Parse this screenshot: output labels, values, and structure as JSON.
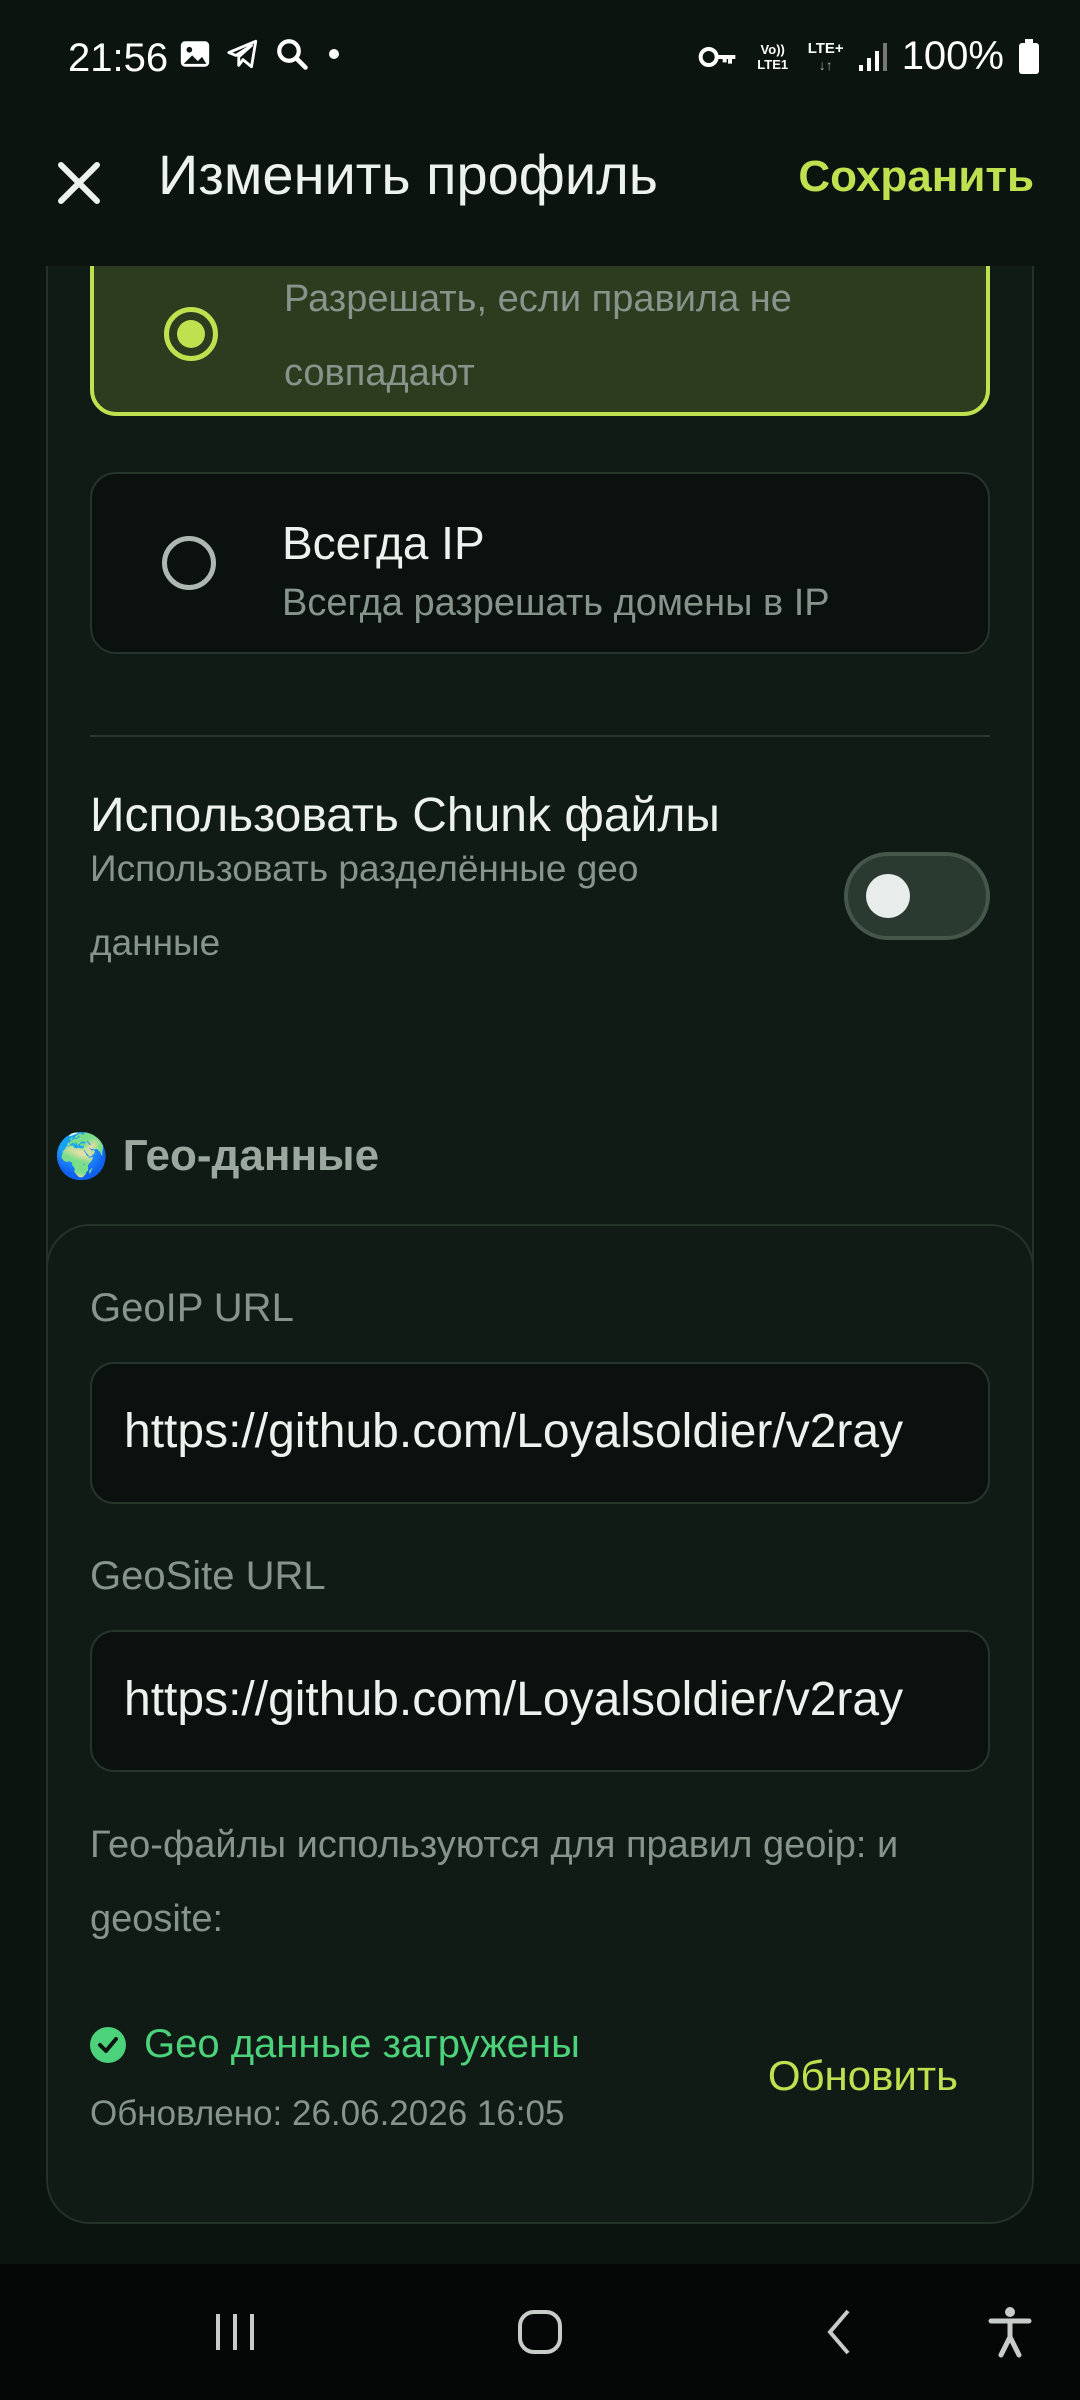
{
  "status_bar": {
    "time": "21:56",
    "network": "Vo)) LTE1",
    "lte": "LTE+",
    "battery": "100%"
  },
  "app_bar": {
    "title": "Изменить профиль",
    "save_label": "Сохранить"
  },
  "dns_options": [
    {
      "title": "",
      "subtitle": "Разрешать, если правила не совпадают",
      "selected": true
    },
    {
      "title": "Всегда IP",
      "subtitle": "Всегда разрешать домены в IP",
      "selected": false
    }
  ],
  "chunk": {
    "title": "Использовать Chunk файлы",
    "subtitle": "Использовать разделённые geo данные",
    "enabled": false
  },
  "geo": {
    "emoji": "🌍",
    "heading": "Гео-данные",
    "geoip_label": "GeoIP URL",
    "geoip_value": "https://github.com/Loyalsoldier/v2ray",
    "geosite_label": "GeoSite URL",
    "geosite_value": "https://github.com/Loyalsoldier/v2ray",
    "note": "Гео-файлы используются для правил geoip: и geosite:",
    "status": "Geo данные загружены",
    "updated": "Обновлено: 26.06.2026 16:05",
    "update_button": "Обновить"
  },
  "colors": {
    "accent": "#bfe04f",
    "success": "#4bd27a",
    "background": "#0c1410",
    "card": "#111b16"
  }
}
